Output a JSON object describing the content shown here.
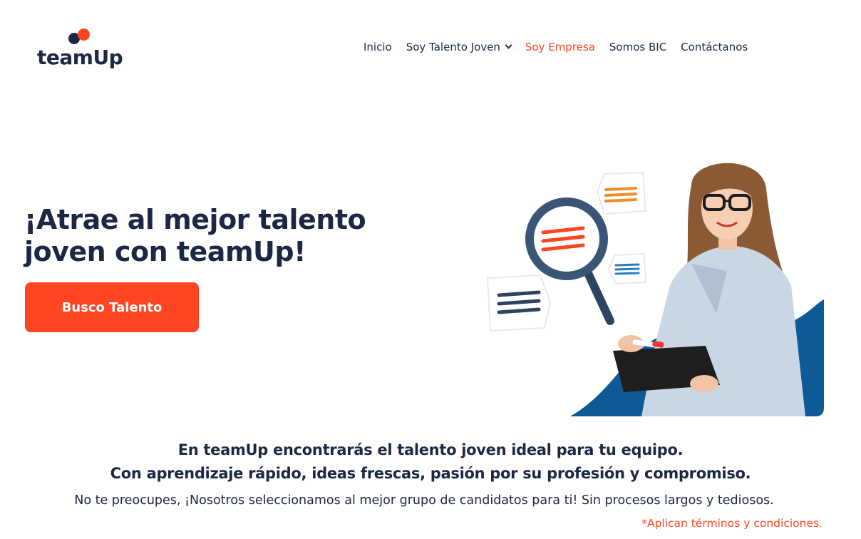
{
  "brand": {
    "logo_text": "teamUp",
    "colors": {
      "navy": "#1b2744",
      "orange": "#ff4521",
      "blue": "#0d5a96"
    }
  },
  "nav": {
    "items": [
      {
        "label": "Inicio",
        "active": false
      },
      {
        "label": "Soy Talento Joven",
        "active": false,
        "has_dropdown": true
      },
      {
        "label": "Soy Empresa",
        "active": true
      },
      {
        "label": "Somos BIC",
        "active": false
      },
      {
        "label": "Contáctanos",
        "active": false
      }
    ]
  },
  "hero": {
    "title_line1": "¡Atrae al mejor talento",
    "title_line2": "joven con teamUp!",
    "cta_label": "Busco Talento"
  },
  "content": {
    "tagline_line1": "En teamUp encontrarás el talento joven ideal para tu equipo.",
    "tagline_line2": "Con aprendizaje rápido, ideas frescas, pasión por su profesión y compromiso.",
    "subtext": "No te preocupes, ¡Nosotros seleccionamos al mejor grupo de candidatos para ti! Sin procesos largos y tediosos.",
    "terms": "*Aplican términos y condiciones."
  }
}
